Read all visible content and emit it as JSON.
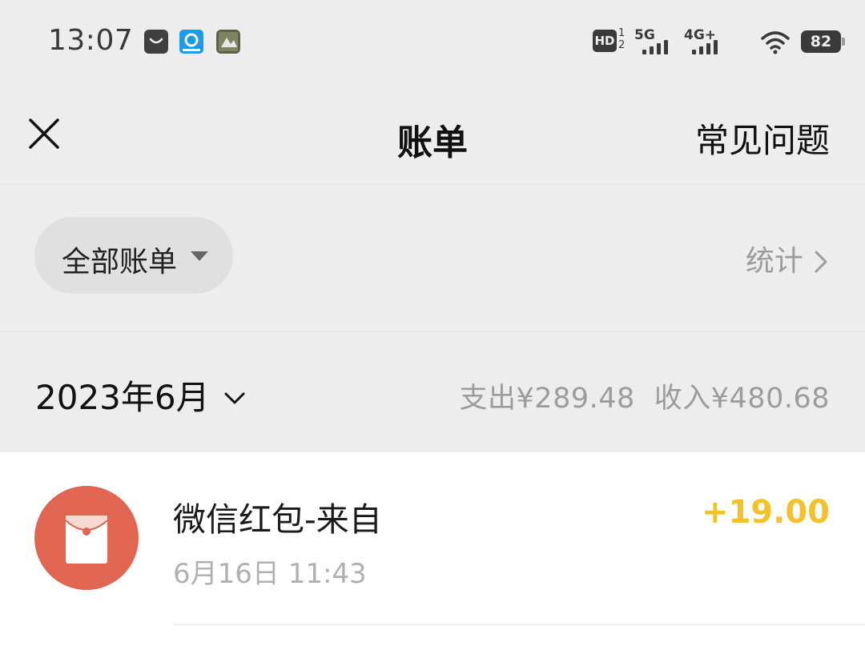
{
  "status_bar": {
    "time": "13:07",
    "app_icons": [
      "shopping-bag-icon",
      "eleme-app-icon",
      "photo-app-icon"
    ],
    "hd_badge": "HD",
    "hd_sub": "1\n2",
    "sim1_label": "5G",
    "sim2_label": "4G+",
    "battery_level": "82"
  },
  "nav": {
    "title": "账单",
    "faq_label": "常见问题"
  },
  "filter": {
    "selected": "全部账单",
    "stats_label": "统计"
  },
  "month": {
    "label": "2023年6月",
    "expense": "支出¥289.48",
    "income": "收入¥480.68"
  },
  "transactions": [
    {
      "title": "微信红包-来自",
      "time": "6月16日 11:43",
      "amount": "+19.00",
      "icon": "red-packet-icon"
    }
  ],
  "colors": {
    "background": "#ededed",
    "list_background": "#ffffff",
    "red_packet": "#e06651",
    "income_amount": "#f3c22a",
    "muted_text": "#9c9c9c"
  }
}
